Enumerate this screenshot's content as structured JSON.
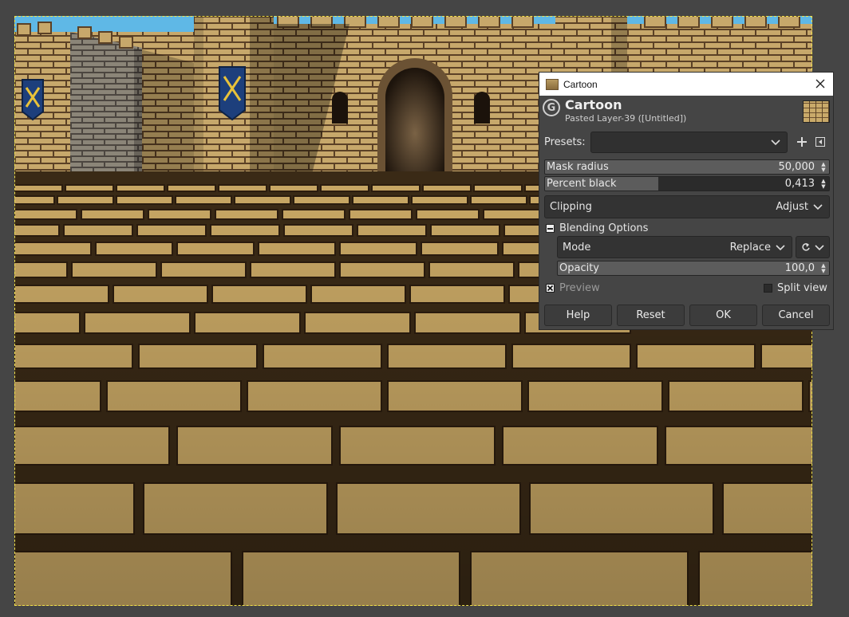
{
  "dialog": {
    "window_title": "Cartoon",
    "op_title": "Cartoon",
    "op_subtitle": "Pasted Layer-39 ([Untitled])",
    "presets_label": "Presets:",
    "presets_value": "",
    "mask_radius": {
      "label": "Mask radius",
      "value": "50,000",
      "fraction": 1.0
    },
    "percent_black": {
      "label": "Percent black",
      "value": "0,413",
      "fraction": 0.4
    },
    "clipping": {
      "label": "Clipping",
      "value": "Adjust"
    },
    "blending": {
      "label": "Blending Options",
      "mode_label": "Mode",
      "mode_value": "Replace",
      "opacity_label": "Opacity",
      "opacity_value": "100,0",
      "opacity_fraction": 1.0
    },
    "preview_label": "Preview",
    "preview_checked": true,
    "split_view_label": "Split view",
    "split_view_checked": false,
    "buttons": {
      "help": "Help",
      "reset": "Reset",
      "ok": "OK",
      "cancel": "Cancel"
    }
  },
  "icons": {
    "close": "close-icon",
    "add_preset": "plus-icon",
    "manage_presets": "menu-arrow-icon",
    "composite_mode": "reset-arrow-icon"
  },
  "colors": {
    "dialog_bg": "#454545",
    "selection_marching_ants": "#f2e24a",
    "slider_fill": "#5c5c5c"
  }
}
